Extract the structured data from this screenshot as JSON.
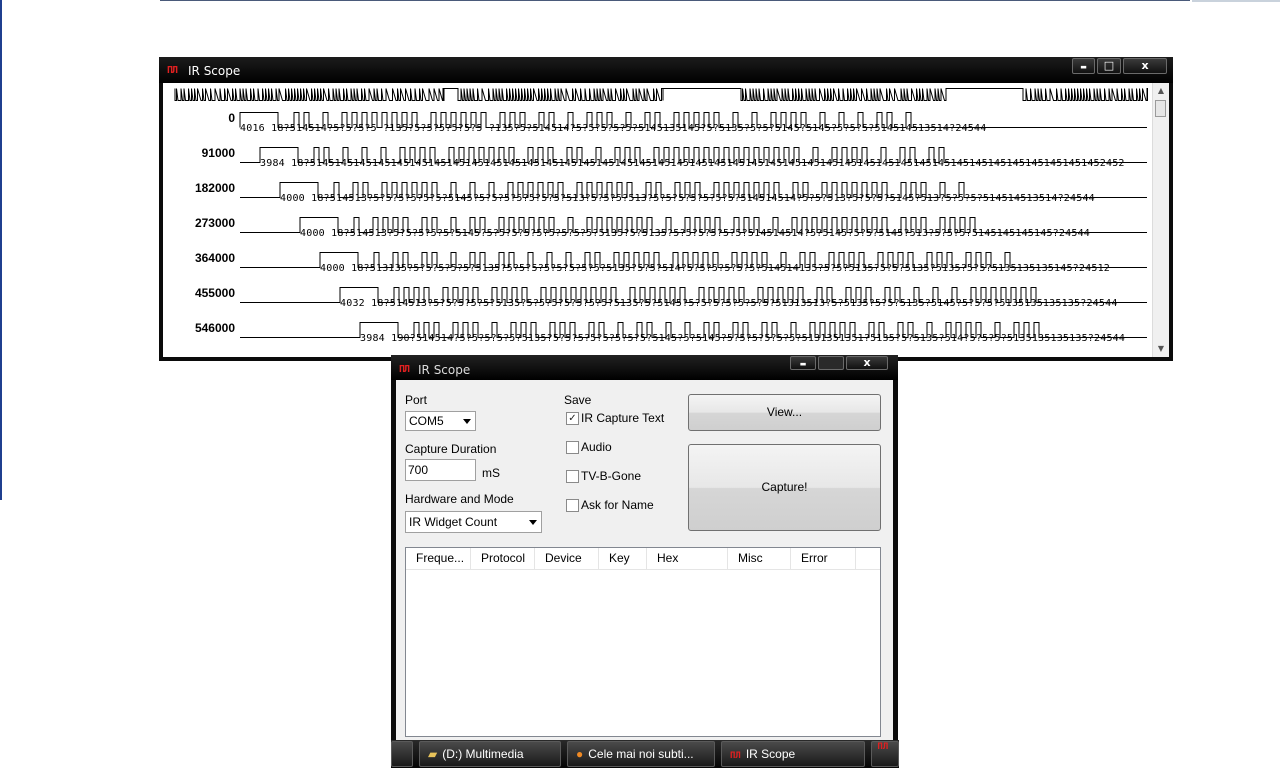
{
  "scope_window": {
    "title": "IR Scope",
    "icon_glyph": "ΠЛ",
    "buttons": {
      "minimize": "▬",
      "maximize": "□",
      "close": "x"
    },
    "traces": [
      {
        "label": "0",
        "timing": "4016  18?514514?5?5?5?5 ?135?5?5?5?5?5?5 ?135?5?514514?5?5?5?5?5?5145135145?5?5135?5?5?5145?5145?5?5?5?514514513514?24544"
      },
      {
        "label": "91000",
        "timing": "3984  18?51451451451451451451451451451451451451451451451451451451451451451451451451451451451451451451451451451451451451451451451451451452452"
      },
      {
        "label": "182000",
        "timing": "4000  18?514513?5?5?5?5?5?5?5145?5?5?5?5?5?5?5?513?5?5?5?513?5?5?5?5?5?5?5?514514514?5?5?513?5?5?5?5145?513?5?5?5?514514513514?24544"
      },
      {
        "label": "273000",
        "timing": "4000  18?514513?5?5?5?5?5?5145?5?5?5?5?5?5?5?5?5?5135?5?5135?5?5?5?5?5?5?514514514?5?5145?5?5?5145?513?5?5?5?5145145145145?24544"
      },
      {
        "label": "364000",
        "timing": "4000  18?513135?5?5?5?5?5?5135?5?5?5?5?5?5?5?5?5135?5?5?514?5?5?5?5?5?5?514514135?5?5?5135?5?5?5135?5135?5?5?5135135135145?24512"
      },
      {
        "label": "455000",
        "timing": "4032  18?514513?5?5?5?5?5?5135?5?5?5?5?5?5?5?5135?5?5145?5?5?5?5?5?5?5?51313513?5?5135?5?5?5135?5145?5?5?5?5135135135135?24544"
      },
      {
        "label": "546000",
        "timing": "3984  190?514514?5?5?5?5?5?5135?5?5?5?5?5?5?5?5?5145?5?5145?5?5?5?5?5?5?5131351351?5135?5?5135?514?5?5?5?5135135135135?24544"
      }
    ]
  },
  "capture_dialog": {
    "title": "IR Scope",
    "icon_glyph": "ΠЛ",
    "buttons": {
      "minimize": "▬",
      "close": "x"
    },
    "port": {
      "label": "Port",
      "value": "COM5"
    },
    "capture_duration": {
      "label": "Capture Duration",
      "value": "700",
      "unit": "mS"
    },
    "hardware_mode": {
      "label": "Hardware and Mode",
      "value": "IR Widget Count"
    },
    "save": {
      "label": "Save",
      "options": [
        {
          "label": "IR Capture Text",
          "checked": true
        },
        {
          "label": "Audio",
          "checked": false
        },
        {
          "label": "TV-B-Gone",
          "checked": false
        },
        {
          "label": "Ask for Name",
          "checked": false
        }
      ]
    },
    "view_button": "View...",
    "capture_button": "Capture!",
    "results_columns": [
      "Freque...",
      "Protocol",
      "Device",
      "Key",
      "Hex",
      "Misc",
      "Error"
    ]
  },
  "taskbar": {
    "items": [
      {
        "label": "(D:) Multimedia",
        "icon": "folder-icon"
      },
      {
        "label": "Cele mai noi subti...",
        "icon": "firefox-icon"
      },
      {
        "label": "IR Scope",
        "icon": "irscope-icon"
      }
    ]
  }
}
